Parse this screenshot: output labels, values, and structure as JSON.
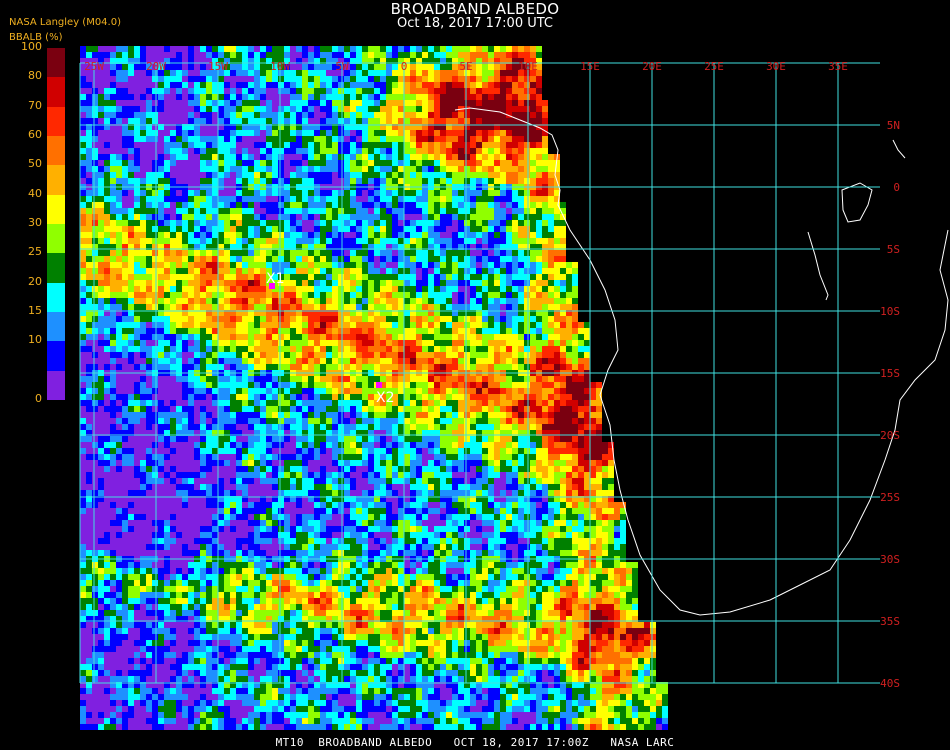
{
  "header": {
    "title": "BROADBAND ALBEDO",
    "subtitle": "Oct 18, 2017 17:00 UTC",
    "source": "NASA Langley (M04.0)",
    "units": "BBALB (%)"
  },
  "colorbar": {
    "ticks": [
      "100",
      "80",
      "70",
      "60",
      "50",
      "40",
      "30",
      "25",
      "20",
      "15",
      "10",
      "0"
    ],
    "colors": [
      "#7a0010",
      "#d00000",
      "#ff2800",
      "#ff7000",
      "#ffb000",
      "#ffff00",
      "#90ff00",
      "#008000",
      "#00ffff",
      "#1e90ff",
      "#0000ff",
      "#8020e0"
    ]
  },
  "map": {
    "grid_color": "#40e0e0",
    "label_color": "#d02020",
    "lon_labels": [
      "25W",
      "20W",
      "15W",
      "10W",
      "5W",
      "0",
      "5E",
      "10E",
      "15E",
      "20E",
      "25E",
      "30E",
      "35E"
    ],
    "lat_labels": [
      "5N",
      "0",
      "5S",
      "10S",
      "15S",
      "20S",
      "25S",
      "30S",
      "35S",
      "40S"
    ],
    "markers": [
      {
        "label": "X1",
        "color": "#ff00ff"
      },
      {
        "label": "X2",
        "color": "#ff00ff"
      }
    ]
  },
  "footer": {
    "text": "MT10  BROADBAND ALBEDO   OCT 18, 2017 17:00Z   NASA LARC"
  }
}
